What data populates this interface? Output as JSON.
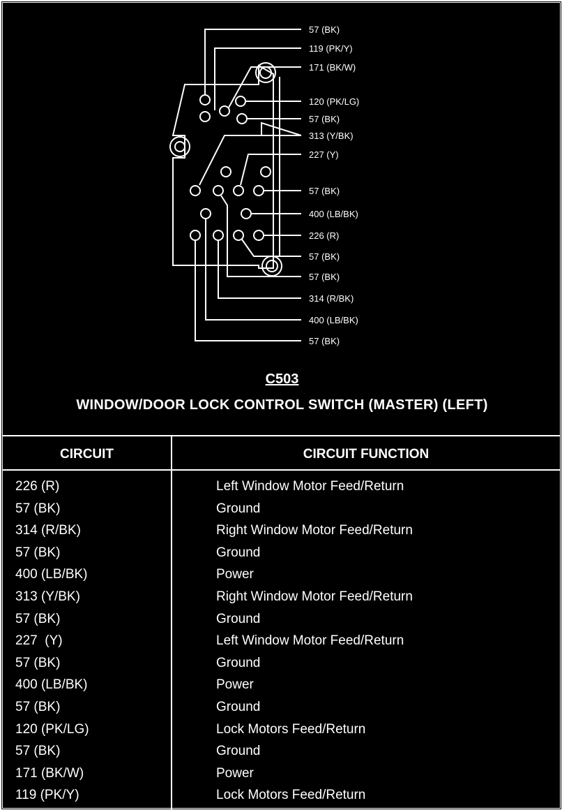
{
  "diagram": {
    "pin_labels": [
      "57 (BK)",
      "119 (PK/Y)",
      "171 (BK/W)",
      "120 (PK/LG)",
      "57 (BK)",
      "313 (Y/BK)",
      "227 (Y)",
      "57 (BK)",
      "400 (LB/BK)",
      "226 (R)",
      "57 (BK)",
      "57 (BK)",
      "314 (R/BK)",
      "400 (LB/BK)",
      "57 (BK)"
    ]
  },
  "connector": {
    "id": "C503",
    "title": "WINDOW/DOOR LOCK CONTROL SWITCH (MASTER) (LEFT)"
  },
  "table": {
    "headers": {
      "circuit": "CIRCUIT",
      "function": "CIRCUIT FUNCTION"
    },
    "rows": [
      {
        "circuit": "226 (R)",
        "function": "Left Window Motor Feed/Return"
      },
      {
        "circuit": "57 (BK)",
        "function": "Ground"
      },
      {
        "circuit": "314 (R/BK)",
        "function": "Right Window Motor Feed/Return"
      },
      {
        "circuit": "57 (BK)",
        "function": "Ground"
      },
      {
        "circuit": "400 (LB/BK)",
        "function": "Power"
      },
      {
        "circuit": "313 (Y/BK)",
        "function": "Right Window Motor Feed/Return"
      },
      {
        "circuit": "57 (BK)",
        "function": "Ground"
      },
      {
        "circuit": "227  (Y)",
        "function": "Left Window Motor Feed/Return"
      },
      {
        "circuit": "57 (BK)",
        "function": "Ground"
      },
      {
        "circuit": "400 (LB/BK)",
        "function": "Power"
      },
      {
        "circuit": "57 (BK)",
        "function": "Ground"
      },
      {
        "circuit": "120 (PK/LG)",
        "function": "Lock Motors Feed/Return"
      },
      {
        "circuit": "57 (BK)",
        "function": "Ground"
      },
      {
        "circuit": "171 (BK/W)",
        "function": "Power"
      },
      {
        "circuit": "119 (PK/Y)",
        "function": "Lock Motors Feed/Return"
      }
    ]
  }
}
